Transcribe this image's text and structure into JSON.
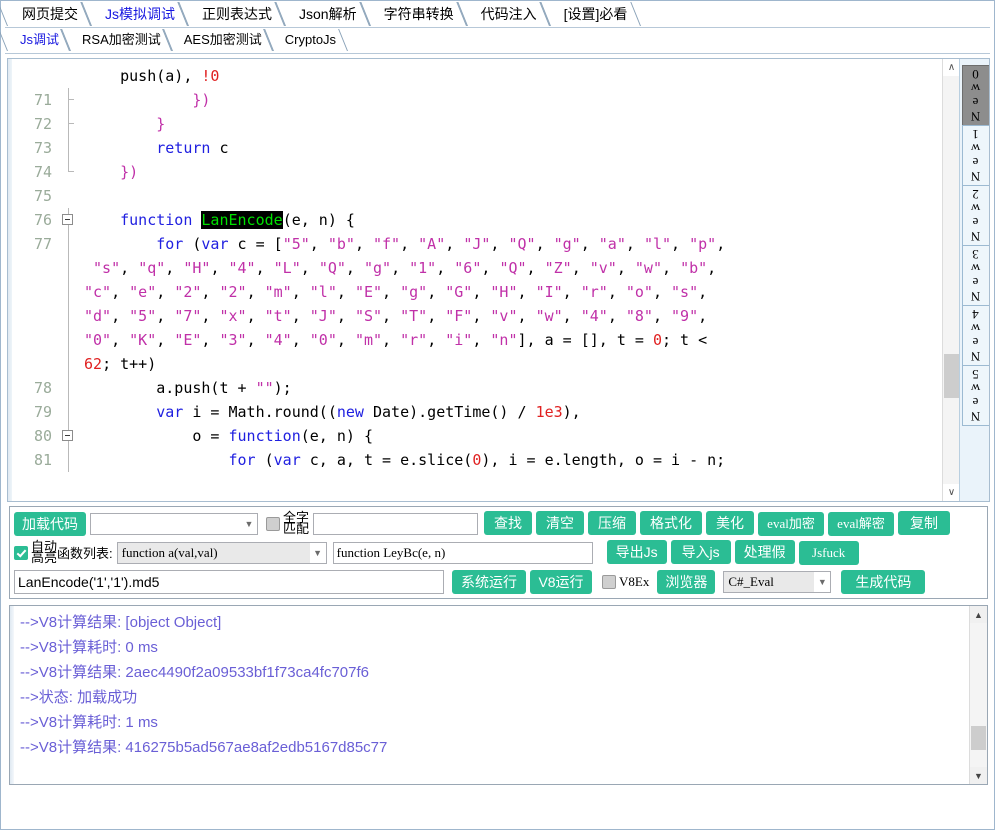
{
  "window": {
    "accent_green": "#2bbd94",
    "tab_active_color": "#1717e0",
    "log_text_color": "#6a5fd6"
  },
  "tabs_primary": [
    {
      "label": "网页提交",
      "active": false
    },
    {
      "label": "Js模拟调试",
      "active": true
    },
    {
      "label": "正则表达式",
      "active": false
    },
    {
      "label": "Json解析",
      "active": false
    },
    {
      "label": "字符串转换",
      "active": false
    },
    {
      "label": "代码注入",
      "active": false
    },
    {
      "label": "[设置]必看",
      "active": false
    }
  ],
  "tabs_secondary": [
    {
      "label": "Js调试",
      "active": true
    },
    {
      "label": "RSA加密测试",
      "active": false
    },
    {
      "label": "AES加密测试",
      "active": false
    },
    {
      "label": "CryptoJs",
      "active": false
    }
  ],
  "editor": {
    "lines": [
      {
        "num": "",
        "fold": "none",
        "text_html": "<span class=\"pl\">    push(a), </span><span class=\"num\">!0</span>"
      },
      {
        "num": "71",
        "fold": "brk",
        "text_html": "<span class=\"str\">            })</span>"
      },
      {
        "num": "72",
        "fold": "brk",
        "text_html": "<span class=\"str\">        }</span>"
      },
      {
        "num": "73",
        "fold": "line",
        "text_html": "<span class=\"kw\">        return</span><span class=\"pl\"> c</span>"
      },
      {
        "num": "74",
        "fold": "end",
        "text_html": "<span class=\"str\">    })</span>"
      },
      {
        "num": "75",
        "fold": "none",
        "text_html": " "
      },
      {
        "num": "76",
        "fold": "box",
        "text_html": "<span class=\"kw\">    function </span><span class=\"hl\">LanEncode</span><span class=\"pl\">(e, n) {</span>"
      },
      {
        "num": "77",
        "fold": "line",
        "text_html": "<span class=\"kw\">        for</span><span class=\"pl\"> (</span><span class=\"kw\">var</span><span class=\"pl\"> c = [</span><span class=\"str\">\"5\"</span><span class=\"pl\">, </span><span class=\"str\">\"b\"</span><span class=\"pl\">, </span><span class=\"str\">\"f\"</span><span class=\"pl\">, </span><span class=\"str\">\"A\"</span><span class=\"pl\">, </span><span class=\"str\">\"J\"</span><span class=\"pl\">, </span><span class=\"str\">\"Q\"</span><span class=\"pl\">, </span><span class=\"str\">\"g\"</span><span class=\"pl\">, </span><span class=\"str\">\"a\"</span><span class=\"pl\">, </span><span class=\"str\">\"l\"</span><span class=\"pl\">, </span><span class=\"str\">\"p\"</span><span class=\"pl\">,</span>"
      },
      {
        "num": "",
        "fold": "line",
        "text_html": "<span class=\"pl\"> </span><span class=\"str\">\"s\"</span><span class=\"pl\">, </span><span class=\"str\">\"q\"</span><span class=\"pl\">, </span><span class=\"str\">\"H\"</span><span class=\"pl\">, </span><span class=\"str\">\"4\"</span><span class=\"pl\">, </span><span class=\"str\">\"L\"</span><span class=\"pl\">, </span><span class=\"str\">\"Q\"</span><span class=\"pl\">, </span><span class=\"str\">\"g\"</span><span class=\"pl\">, </span><span class=\"str\">\"1\"</span><span class=\"pl\">, </span><span class=\"str\">\"6\"</span><span class=\"pl\">, </span><span class=\"str\">\"Q\"</span><span class=\"pl\">, </span><span class=\"str\">\"Z\"</span><span class=\"pl\">, </span><span class=\"str\">\"v\"</span><span class=\"pl\">, </span><span class=\"str\">\"w\"</span><span class=\"pl\">, </span><span class=\"str\">\"b\"</span><span class=\"pl\">,</span>"
      },
      {
        "num": "",
        "fold": "line",
        "text_html": "<span class=\"str\">\"c\"</span><span class=\"pl\">, </span><span class=\"str\">\"e\"</span><span class=\"pl\">, </span><span class=\"str\">\"2\"</span><span class=\"pl\">, </span><span class=\"str\">\"2\"</span><span class=\"pl\">, </span><span class=\"str\">\"m\"</span><span class=\"pl\">, </span><span class=\"str\">\"l\"</span><span class=\"pl\">, </span><span class=\"str\">\"E\"</span><span class=\"pl\">, </span><span class=\"str\">\"g\"</span><span class=\"pl\">, </span><span class=\"str\">\"G\"</span><span class=\"pl\">, </span><span class=\"str\">\"H\"</span><span class=\"pl\">, </span><span class=\"str\">\"I\"</span><span class=\"pl\">, </span><span class=\"str\">\"r\"</span><span class=\"pl\">, </span><span class=\"str\">\"o\"</span><span class=\"pl\">, </span><span class=\"str\">\"s\"</span><span class=\"pl\">,</span>"
      },
      {
        "num": "",
        "fold": "line",
        "text_html": "<span class=\"str\">\"d\"</span><span class=\"pl\">, </span><span class=\"str\">\"5\"</span><span class=\"pl\">, </span><span class=\"str\">\"7\"</span><span class=\"pl\">, </span><span class=\"str\">\"x\"</span><span class=\"pl\">, </span><span class=\"str\">\"t\"</span><span class=\"pl\">, </span><span class=\"str\">\"J\"</span><span class=\"pl\">, </span><span class=\"str\">\"S\"</span><span class=\"pl\">, </span><span class=\"str\">\"T\"</span><span class=\"pl\">, </span><span class=\"str\">\"F\"</span><span class=\"pl\">, </span><span class=\"str\">\"v\"</span><span class=\"pl\">, </span><span class=\"str\">\"w\"</span><span class=\"pl\">, </span><span class=\"str\">\"4\"</span><span class=\"pl\">, </span><span class=\"str\">\"8\"</span><span class=\"pl\">, </span><span class=\"str\">\"9\"</span><span class=\"pl\">,</span>"
      },
      {
        "num": "",
        "fold": "line",
        "text_html": "<span class=\"str\">\"0\"</span><span class=\"pl\">, </span><span class=\"str\">\"K\"</span><span class=\"pl\">, </span><span class=\"str\">\"E\"</span><span class=\"pl\">, </span><span class=\"str\">\"3\"</span><span class=\"pl\">, </span><span class=\"str\">\"4\"</span><span class=\"pl\">, </span><span class=\"str\">\"0\"</span><span class=\"pl\">, </span><span class=\"str\">\"m\"</span><span class=\"pl\">, </span><span class=\"str\">\"r\"</span><span class=\"pl\">, </span><span class=\"str\">\"i\"</span><span class=\"pl\">, </span><span class=\"str\">\"n\"</span><span class=\"pl\">], a = [], t = </span><span class=\"num\">0</span><span class=\"pl\">; t &lt;</span>"
      },
      {
        "num": "",
        "fold": "line",
        "text_html": "<span class=\"num\">62</span><span class=\"pl\">; t++)</span>"
      },
      {
        "num": "78",
        "fold": "line",
        "text_html": "<span class=\"pl\">        a.push(t + </span><span class=\"str\">\"\"</span><span class=\"pl\">);</span>"
      },
      {
        "num": "79",
        "fold": "line",
        "text_html": "<span class=\"kw\">        var</span><span class=\"pl\"> i = Math.round((</span><span class=\"kw\">new</span><span class=\"pl\"> Date).getTime() / </span><span class=\"num\">1e3</span><span class=\"pl\">),</span>"
      },
      {
        "num": "80",
        "fold": "box",
        "text_html": "<span class=\"pl\">            o = </span><span class=\"kw\">function</span><span class=\"pl\">(e, n) {</span>"
      },
      {
        "num": "81",
        "fold": "line",
        "text_html": "<span class=\"kw\">                for</span><span class=\"pl\"> (</span><span class=\"kw\">var</span><span class=\"pl\"> c, a, t = e.slice(</span><span class=\"num\">0</span><span class=\"pl\">), i = e.length, o = i - n;</span>"
      }
    ],
    "scrollbar": {
      "up_glyph": "∧",
      "down_glyph": "∨"
    }
  },
  "vertical_tabs": [
    {
      "label": "New0",
      "active": true
    },
    {
      "label": "New1",
      "active": false
    },
    {
      "label": "New2",
      "active": false
    },
    {
      "label": "New3",
      "active": false
    },
    {
      "label": "New4",
      "active": false
    },
    {
      "label": "New5",
      "active": false
    }
  ],
  "toolbar": {
    "row1": {
      "load_code_label": "加载代码",
      "file_combo_value": "",
      "whole_word_label_top": "全字",
      "whole_word_label_bottom": "匹配",
      "whole_word_checked": false,
      "find_input_value": "",
      "buttons": [
        "查找",
        "清空",
        "压缩",
        "格式化",
        "美化",
        "eval加密",
        "eval解密",
        "复制"
      ]
    },
    "row2": {
      "auto_label_top": "自动",
      "auto_label_bottom": "高亮",
      "auto_checked": true,
      "function_list_label": "函数列表:",
      "function_combo_value": "function a(val,val)",
      "function_signature_value": "function LeyBc(e, n)",
      "buttons": [
        "导出Js",
        "导入js",
        "处理假",
        "Jsfuck"
      ]
    },
    "row3": {
      "expression_value": "LanEncode('1','1').md5",
      "run_system_label": "系统运行",
      "run_v8_label": "V8运行",
      "v8ex_label": "V8Ex",
      "v8ex_checked": false,
      "browser_label": "浏览器",
      "eval_mode_value": "C#_Eval",
      "generate_code_label": "生成代码"
    }
  },
  "output": {
    "lines": [
      "-->V8计算结果: [object Object]",
      "-->V8计算耗时: 0 ms",
      "-->V8计算结果: 2aec4490f2a09533bf1f73ca4fc707f6",
      "-->状态: 加载成功",
      "-->V8计算耗时: 1 ms",
      "-->V8计算结果: 416275b5ad567ae8af2edb5167d85c77"
    ],
    "scrollbar": {
      "up_glyph": "▲",
      "down_glyph": "▼"
    }
  }
}
